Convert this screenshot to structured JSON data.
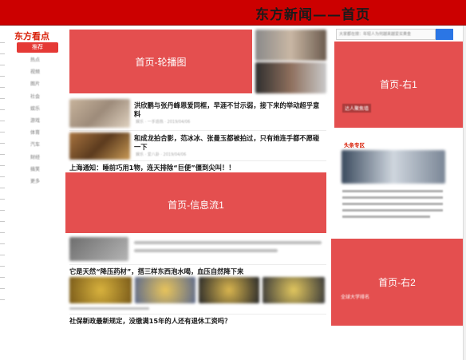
{
  "page": {
    "title": "东方新闻——首页"
  },
  "brand": {
    "logo_text": "东方看点"
  },
  "nav": {
    "active_label": "推荐",
    "items": [
      "热点",
      "视频",
      "图片",
      "社会",
      "娱乐",
      "游戏",
      "体育",
      "汽车",
      "财经",
      "搞笑",
      "更多"
    ]
  },
  "search": {
    "placeholder": "大家都在搜：年轻人为何越来越爱买黄金"
  },
  "regions": {
    "carousel": "首页-轮播图",
    "right1": "首页-右1",
    "feed": "首页-信息流1",
    "right2": "首页-右2"
  },
  "feed": {
    "item1": {
      "headline": "洪欣鹏与张丹峰恩爱同框，早涯不甘示弱，接下来的举动超乎意料",
      "meta": "娱乐 · 一手追热 · 2019/04/06"
    },
    "item2": {
      "headline": "和成龙拍合影，范冰冰、张曼玉都被拍过，只有她连手都不愿碰一下",
      "meta": "娱乐 · 爱八卦 · 2019/04/06"
    },
    "item3": {
      "headline": "上海通知：睡前巧用1物，连天排除“巨便”僵到尖叫！！"
    },
    "item4": {
      "headline": "它是天然“降压药材”，搭三样东西泡水喝，血压自然降下来"
    },
    "item5": {
      "headline": "社保新政最新规定，没缴满15年的人还有退休工资吗？"
    }
  },
  "right": {
    "section_label": "头条专区",
    "ad_label": "达人聚焦墙",
    "sidebar_headline_label": "全球大学排名"
  },
  "colors": {
    "brand_red": "#cc0000",
    "overlay_red": "#dc1e1e",
    "search_blue": "#2b76e5"
  }
}
